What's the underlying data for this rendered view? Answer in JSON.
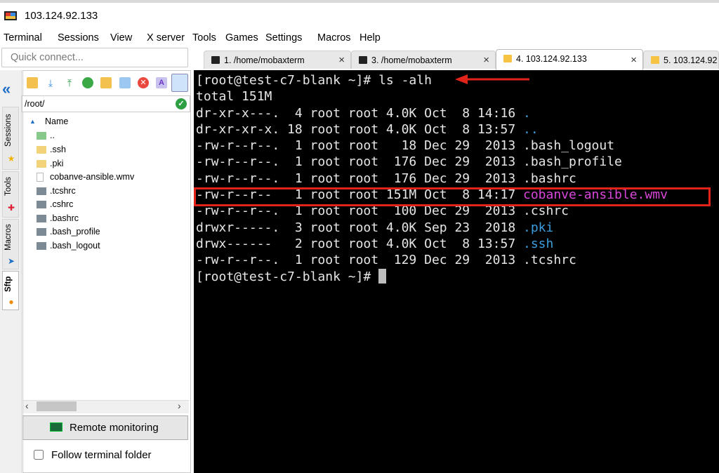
{
  "window": {
    "title": "103.124.92.133"
  },
  "menu": [
    "Terminal",
    "Sessions",
    "View",
    "X server",
    "Tools",
    "Games",
    "Settings",
    "Macros",
    "Help"
  ],
  "quick_connect": {
    "placeholder": "Quick connect..."
  },
  "tabs": [
    {
      "label": "1. /home/mobaxterm"
    },
    {
      "label": "3. /home/mobaxterm"
    },
    {
      "label": "4.  103.124.92.133"
    },
    {
      "label": "5.  103.124.92"
    }
  ],
  "side_tabs": [
    "Sessions",
    "Tools",
    "Macros",
    "Sftp"
  ],
  "sftp": {
    "path": "/root/",
    "column_header": "Name",
    "files": [
      {
        "name": "..",
        "type": "up"
      },
      {
        "name": ".ssh",
        "type": "folder"
      },
      {
        "name": ".pki",
        "type": "folder"
      },
      {
        "name": "cobanve-ansible.wmv",
        "type": "video"
      },
      {
        "name": ".tcshrc",
        "type": "file"
      },
      {
        "name": ".cshrc",
        "type": "file"
      },
      {
        "name": ".bashrc",
        "type": "file"
      },
      {
        "name": ".bash_profile",
        "type": "file"
      },
      {
        "name": ".bash_logout",
        "type": "file"
      }
    ],
    "remote_monitoring_label": "Remote monitoring",
    "follow_terminal_label": "Follow terminal folder"
  },
  "terminal": {
    "prompt_line": "[root@test-c7-blank ~]# ls -alh",
    "total": "total 151M",
    "listing": [
      {
        "text": "dr-xr-x---.  4 root root 4.0K Oct  8 14:16 ",
        "name": ".",
        "style": "dir"
      },
      {
        "text": "dr-xr-xr-x. 18 root root 4.0K Oct  8 13:57 ",
        "name": "..",
        "style": "dir"
      },
      {
        "text": "-rw-r--r--.  1 root root   18 Dec 29  2013 ",
        "name": ".bash_logout",
        "style": "plain"
      },
      {
        "text": "-rw-r--r--.  1 root root  176 Dec 29  2013 ",
        "name": ".bash_profile",
        "style": "plain"
      },
      {
        "text": "-rw-r--r--.  1 root root  176 Dec 29  2013 ",
        "name": ".bashrc",
        "style": "plain"
      },
      {
        "text": "-rw-r--r--   1 root root 151M Oct  8 14:17 ",
        "name": "cobanve-ansible.wmv",
        "style": "video"
      },
      {
        "text": "-rw-r--r--.  1 root root  100 Dec 29  2013 ",
        "name": ".cshrc",
        "style": "plain"
      },
      {
        "text": "drwxr-----.  3 root root 4.0K Sep 23  2018 ",
        "name": ".pki",
        "style": "dir"
      },
      {
        "text": "drwx------   2 root root 4.0K Oct  8 13:57 ",
        "name": ".ssh",
        "style": "dir"
      },
      {
        "text": "-rw-r--r--.  1 root root  129 Dec 29  2013 ",
        "name": ".tcshrc",
        "style": "plain"
      }
    ],
    "final_prompt": "[root@test-c7-blank ~]# "
  },
  "colors": {
    "highlight_box": "#e2231a",
    "dir": "#3b9ddd",
    "video": "#d946d9"
  }
}
